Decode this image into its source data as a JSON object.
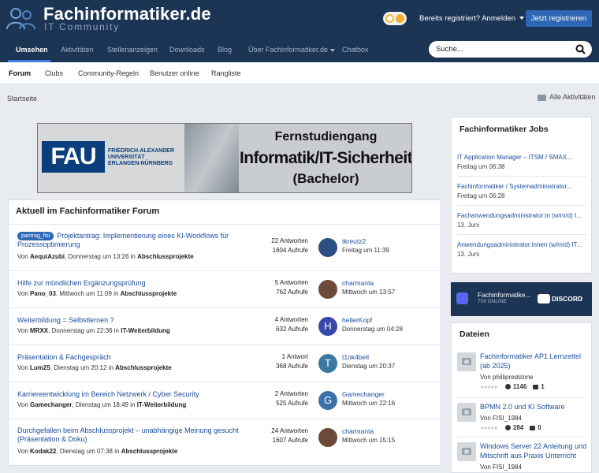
{
  "site": {
    "title": "Fachinformatiker.de",
    "subtitle": "IT Community"
  },
  "header": {
    "signin": "Bereits registriert? Anmelden",
    "register": "Jetzt registrieren"
  },
  "nav": {
    "items": [
      "Umsehen",
      "Aktivitäten",
      "Stellenanzeigen",
      "Downloads",
      "Blog",
      "Über Fachinformatiker.de",
      "Chatbox"
    ]
  },
  "search": {
    "placeholder": "Suche..."
  },
  "subnav": {
    "items": [
      "Forum",
      "Clubs",
      "Community-Regeln",
      "Benutzer online",
      "Rangliste"
    ]
  },
  "breadcrumb": "Startseite",
  "all_activities": "Alle Aktivitäten",
  "banner": {
    "logo": "FAU",
    "uni_line1": "FRIEDRICH-ALEXANDER",
    "uni_line2": "UNIVERSITÄT",
    "uni_line3": "ERLANGEN-NÜRNBERG",
    "line1": "Fernstudiengang",
    "line2": "Informatik/IT-Sicherheit",
    "line3": "(Bachelor)"
  },
  "forum": {
    "title": "Aktuell im Fachinformatiker Forum",
    "topics": [
      {
        "tag": "pantrag_fisi",
        "title": "Projektantrag: Implementierung eines KI-Workflows für Prozessoptimierung",
        "by": "Von",
        "author": "AequiAzubi",
        "date": "Donnerstag um 13:26",
        "in": "in",
        "forum": "Abschlussprojekte",
        "answers": "22 Antworten",
        "views": "1604 Aufrufe",
        "last_user": "tkreutz2",
        "last_date": "Freitag um 11:39",
        "avatar": "",
        "avatar_color": "#2a4f80"
      },
      {
        "tag": "",
        "title": "Hilfe zur mündlichen Ergänzungsprüfung",
        "by": "Von",
        "author": "Pano_03",
        "date": "Mittwoch um 11:09",
        "in": "in",
        "forum": "Abschlussprojekte",
        "answers": "5 Antworten",
        "views": "762 Aufrufe",
        "last_user": "charmanta",
        "last_date": "Mittwoch um 13:57",
        "avatar": "",
        "avatar_color": "#6b4a3a"
      },
      {
        "tag": "",
        "title": "Weiterbildung = Selbstlernen ?",
        "by": "Von",
        "author": "MRXX",
        "date": "Donnerstag um 22:36",
        "in": "in",
        "forum": "IT-Weiterbildung",
        "answers": "4 Antworten",
        "views": "632 Aufrufe",
        "last_user": "hellerKopf",
        "last_date": "Donnerstag um 04:28",
        "avatar": "H",
        "avatar_color": "#3848a8"
      },
      {
        "tag": "",
        "title": "Präsentation & Fachgespräch",
        "by": "Von",
        "author": "Lum25",
        "date": "Dienstag um 20:12",
        "in": "in",
        "forum": "Abschlussprojekte",
        "answers": "1 Antwort",
        "views": "368 Aufrufe",
        "last_user": "t1nk4bell",
        "last_date": "Dienstag um 20:37",
        "avatar": "T",
        "avatar_color": "#3a7aa0"
      },
      {
        "tag": "",
        "title": "Karriereentwicklung im Bereich Netzwerk / Cyber Security",
        "by": "Von",
        "author": "Gamechanger",
        "date": "Dienstag um 18:49",
        "in": "in",
        "forum": "IT-Weiterbildung",
        "answers": "2 Antworten",
        "views": "525 Aufrufe",
        "last_user": "Gamechanger",
        "last_date": "Mittwoch um 22:16",
        "avatar": "G",
        "avatar_color": "#3a72a8"
      },
      {
        "tag": "",
        "title": "Durchgefallen beim Abschlussprojekt – unabhängige Meinung gesucht (Präsentation & Doku)",
        "by": "Von",
        "author": "Kodak22",
        "date": "Dienstag um 07:38",
        "in": "in",
        "forum": "Abschlussprojekte",
        "answers": "24 Antworten",
        "views": "1607 Aufrufe",
        "last_user": "charmanta",
        "last_date": "Mittwoch um 15:15",
        "avatar": "",
        "avatar_color": "#6b4a3a"
      }
    ]
  },
  "jobs": {
    "title": "Fachinformatiker Jobs",
    "items": [
      {
        "title": "IT Application Manager – ITSM / SMAX...",
        "date": "Freitag um 06:38"
      },
      {
        "title": "Fachinformatiker / Systemadministrator...",
        "date": "Freitag um 06:28"
      },
      {
        "title": "Fachanwendungsadministrator:in (w/m/d) I...",
        "date": "13. Juni"
      },
      {
        "title": "Anwendungsadministrator:innen (w/m/d) IT...",
        "date": "13. Juni"
      }
    ]
  },
  "discord": {
    "name": "Fachinformatike...",
    "online": "759 ONLINE",
    "label": "DISCORD",
    "arrow": "›"
  },
  "files": {
    "title": "Dateien",
    "items": [
      {
        "title": "Fachinformatiker AP1 Lernzettel (ab 2025)",
        "by": "Von phillipredstone",
        "downloads": "1146",
        "comments": "1"
      },
      {
        "title": "BPMN 2.0 und KI Software",
        "by": "Von FISI_1984",
        "downloads": "284",
        "comments": "0"
      },
      {
        "title": "Windows Server 22 Anleitung und Mitschrift aus Praxis Unterricht",
        "by": "Von FISI_1984",
        "downloads": "",
        "comments": ""
      }
    ]
  },
  "colors": {
    "header_bg": "#1c3554",
    "accent": "#2d67b5",
    "link": "#1a4d9c"
  }
}
